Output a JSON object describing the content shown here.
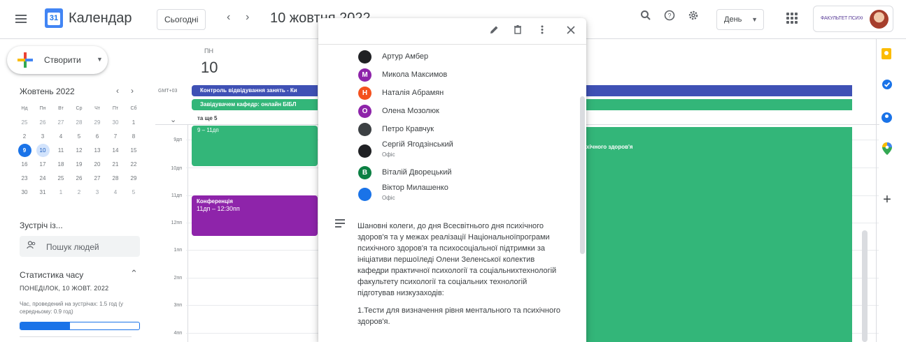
{
  "header": {
    "logo_text": "31",
    "app_title": "Календар",
    "today_label": "Сьогодні",
    "prev": "‹",
    "next": "›",
    "date_title": "10 жовтня 2022",
    "view_label": "День",
    "account_org": "ФАКУЛЬТЕТ ПСИХОЛОГІЇ"
  },
  "sidebar": {
    "create_label": "Створити",
    "mini_month": "Жовтень 2022",
    "mini_prev": "‹",
    "mini_next": "›",
    "weekdays": [
      "Нд",
      "Пн",
      "Вт",
      "Ср",
      "Чт",
      "Пт",
      "Сб"
    ],
    "weeks": [
      [
        "25",
        "26",
        "27",
        "28",
        "29",
        "30",
        "1"
      ],
      [
        "2",
        "3",
        "4",
        "5",
        "6",
        "7",
        "8"
      ],
      [
        "9",
        "10",
        "11",
        "12",
        "13",
        "14",
        "15"
      ],
      [
        "16",
        "17",
        "18",
        "19",
        "20",
        "21",
        "22"
      ],
      [
        "23",
        "24",
        "25",
        "26",
        "27",
        "28",
        "29"
      ],
      [
        "30",
        "31",
        "1",
        "2",
        "3",
        "4",
        "5"
      ]
    ],
    "meet_title": "Зустріч із...",
    "people_search_placeholder": "Пошук людей",
    "stats_title": "Статистика часу",
    "stats_date": "ПОНЕДІЛОК, 10 ЖОВТ. 2022",
    "stats_desc": "Час, проведений на зустрічах: 1.5 год (у середньому: 0.9 год)",
    "stats_progress": 0.42
  },
  "grid": {
    "timezone": "GMT+03",
    "day_name": "ПН",
    "day_number": "10",
    "allday_event_1": "Контроль відвідування занять - Ки",
    "allday_event_2": "Завідувачем кафедр: онлайн БІБЛ",
    "more_label": "та ще 5",
    "hours": [
      "9дп",
      "10дп",
      "11дп",
      "12пп",
      "1пп",
      "2пп",
      "3пп",
      "4пп"
    ],
    "event_green_time": "9 – 11дп",
    "event_green_right_text": "хічного здоров'я",
    "event_conf_title": "Конференція",
    "event_conf_time": "11дп – 12:30пп"
  },
  "popup": {
    "guests": [
      {
        "name": "Артур Амбер",
        "sub": "",
        "initial": "",
        "color": "#202124"
      },
      {
        "name": "Микола Максимов",
        "sub": "",
        "initial": "M",
        "color": "#8e24aa"
      },
      {
        "name": "Наталія Абрамян",
        "sub": "",
        "initial": "Н",
        "color": "#f4511e"
      },
      {
        "name": "Олена Мозолюк",
        "sub": "",
        "initial": "О",
        "color": "#8e24aa"
      },
      {
        "name": "Петро Кравчук",
        "sub": "",
        "initial": "",
        "color": "#3c4043"
      },
      {
        "name": "Сергій Ягодзінський",
        "sub": "Офіс",
        "initial": "",
        "color": "#202124"
      },
      {
        "name": "Віталій Дворецький",
        "sub": "",
        "initial": "В",
        "color": "#0b8043"
      },
      {
        "name": "Віктор Милашенко",
        "sub": "Офіс",
        "initial": "",
        "color": "#1a73e8"
      }
    ],
    "description_1": "Шановні колеги, до дня Всесвітнього дня психічного здоров'я та у межах реалізації Національноїпрограми психічного здоров'я та психосоціальної підтримки за ініціативи першоїледі Олени Зеленської колектив кафедри практичної психології та соціальнихтехнологій факультету психології та соціальних технологій підготував низкузаходів:",
    "description_2": "1.Тести для визначення рівня ментального та психічного здоров'я."
  },
  "colors": {
    "indigo": "#3f51b5",
    "green": "#33b679",
    "purple": "#8e24aa",
    "blue": "#1a73e8"
  }
}
